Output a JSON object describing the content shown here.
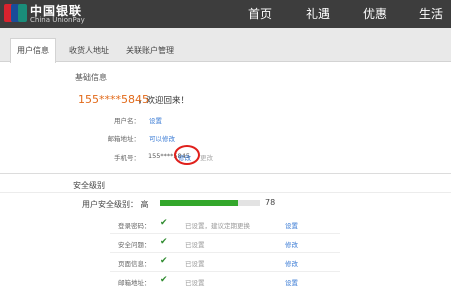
{
  "header": {
    "brand_cn": "中国银联",
    "brand_en": "China UnionPay",
    "nav": [
      "首页",
      "礼遇",
      "优惠",
      "生活"
    ]
  },
  "tabs": [
    {
      "label": "用户信息",
      "active": true
    },
    {
      "label": "收货人地址",
      "active": false
    },
    {
      "label": "关联账户管理",
      "active": false
    }
  ],
  "basic_info": {
    "title": "基础信息",
    "masked_user": "155****5845",
    "welcome": "，欢迎回来！",
    "username_label": "用户名：",
    "username_action": "设置",
    "email_label": "邮箱地址：",
    "email_action": "可以修改",
    "phone_label": "手机号：",
    "phone_value": "155****5845",
    "phone_action": "修改",
    "phone_secondary": "更改"
  },
  "security": {
    "title": "安全级别",
    "level_label": "用户安全级别：",
    "level_value": "高",
    "score": "78",
    "progress_percent": 78,
    "rows": [
      {
        "label": "登录密码：",
        "status": "已设置，建议定期更换",
        "action": "设置"
      },
      {
        "label": "安全问题：",
        "status": "已设置",
        "action": "修改"
      },
      {
        "label": "页面信息：",
        "status": "已设置",
        "action": "修改"
      },
      {
        "label": "邮箱地址：",
        "status": "已设置",
        "action": "设置"
      }
    ]
  },
  "colors": {
    "topbar": "#3d3d3d",
    "accent_orange": "#e26a1a",
    "progress_green": "#33a72b",
    "link_blue": "#3a7bd5",
    "highlight_red": "#e0201c"
  }
}
